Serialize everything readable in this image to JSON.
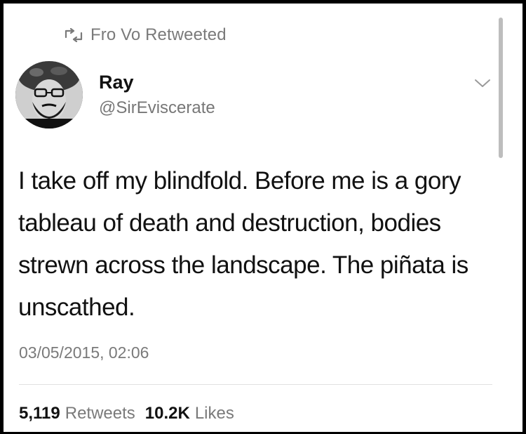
{
  "context": {
    "retweeted_by": "Fro Vo Retweeted",
    "retweet_icon": "retweet-icon"
  },
  "author": {
    "name": "Ray",
    "handle": "@SirEviscerate",
    "avatar_icon": "user-avatar"
  },
  "tweet": {
    "text": "I take off my blindfold. Before me is a gory tableau of death and destruction, bodies strewn across the landscape. The piñata is unscathed.",
    "timestamp": "03/05/2015, 02:06",
    "menu_icon": "chevron-down-icon"
  },
  "stats": {
    "retweets_count": "5,119",
    "retweets_label": "Retweets",
    "likes_count": "10.2K",
    "likes_label": "Likes"
  },
  "colors": {
    "frame": "#000000",
    "background": "#ffffff",
    "text_primary": "#111111",
    "text_secondary": "#7a7a7a"
  }
}
